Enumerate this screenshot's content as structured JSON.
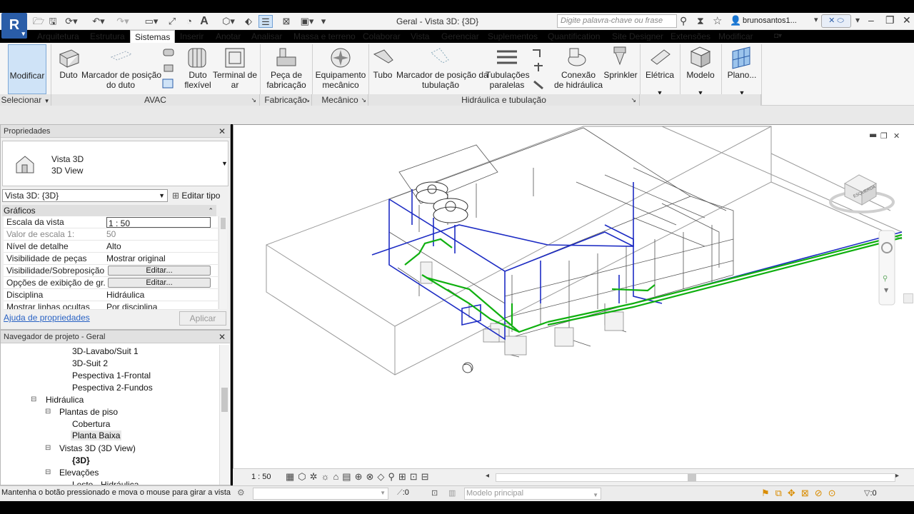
{
  "app": {
    "logo": "R",
    "title": "Geral - Vista 3D: {3D}",
    "search_placeholder": "Digite palavra-chave ou frase",
    "user": "brunosantos1..."
  },
  "quick_access": [
    "open-icon",
    "save-icon",
    "sync-icon",
    "undo-icon",
    "redo-icon",
    "measure-icon",
    "dimension-icon",
    "tag-icon",
    "text-icon",
    "3d-view-icon",
    "section-icon",
    "thin-lines-icon",
    "close-views-icon",
    "switch-windows-icon"
  ],
  "tabs": [
    "Arquitetura",
    "Estrutura",
    "Sistemas",
    "Inserir",
    "Anotar",
    "Analisar",
    "Massa e terreno",
    "Colaborar",
    "Vista",
    "Gerenciar",
    "Suplementos",
    "Quantification",
    "Site Designer",
    "Extensões",
    "Modificar"
  ],
  "active_tab": "Sistemas",
  "ribbon": {
    "buttons": [
      {
        "label": "Modificar",
        "icon": "cursor-icon"
      },
      {
        "label": "Duto",
        "icon": "duct-icon"
      },
      {
        "label": "Marcador de posição\ndo duto",
        "icon": "duct-placeholder-icon"
      },
      {
        "label": "Duto\nflexível",
        "icon": "flex-duct-icon"
      },
      {
        "label": "Terminal de\nar",
        "icon": "air-terminal-icon"
      },
      {
        "label": "Peça de\nfabricação",
        "icon": "fabrication-part-icon"
      },
      {
        "label": "Equipamento\nmecânico",
        "icon": "mechanical-equipment-icon"
      },
      {
        "label": "Tubo",
        "icon": "pipe-icon"
      },
      {
        "label": "Marcador de posição da\ntubulação",
        "icon": "pipe-placeholder-icon"
      },
      {
        "label": "Tubulações\nparalelas",
        "icon": "parallel-pipes-icon"
      },
      {
        "label": "Conexão\nde hidráulica",
        "icon": "plumbing-fixture-icon"
      },
      {
        "label": "Sprinkler",
        "icon": "sprinkler-icon"
      },
      {
        "label": "Elétrica",
        "icon": "electrical-icon"
      },
      {
        "label": "Modelo",
        "icon": "model-icon"
      },
      {
        "label": "Plano...",
        "icon": "work-plane-icon"
      }
    ],
    "panels": [
      "Selecionar",
      "AVAC",
      "Fabricação",
      "Mecânico",
      "Hidráulica e tubulação"
    ]
  },
  "properties": {
    "title": "Propriedades",
    "type_name": "Vista 3D",
    "type_sub": "3D View",
    "selector": "Vista 3D: {3D}",
    "edit_type": "Editar tipo",
    "section": "Gráficos",
    "rows": [
      {
        "k": "Escala da vista",
        "v": "1 : 50"
      },
      {
        "k": "Valor de escala    1:",
        "v": "50"
      },
      {
        "k": "Nível de detalhe",
        "v": "Alto"
      },
      {
        "k": "Visibilidade de peças",
        "v": "Mostrar original"
      },
      {
        "k": "Visibilidade/Sobreposição...",
        "v": "Editar..."
      },
      {
        "k": "Opções de exibição de gr...",
        "v": "Editar..."
      },
      {
        "k": "Disciplina",
        "v": "Hidráulica"
      },
      {
        "k": "Mostrar linhas ocultas",
        "v": "Por disciplina"
      }
    ],
    "help": "Ajuda de propriedades",
    "apply": "Aplicar"
  },
  "navigator": {
    "title": "Navegador de projeto - Geral",
    "items": [
      "3D-Lavabo/Suit 1",
      "3D-Suit 2",
      "Pespectiva 1-Frontal",
      "Pespectiva 2-Fundos",
      "Hidráulica",
      "Plantas de piso",
      "Cobertura",
      "Planta Baixa",
      "Vistas 3D (3D View)",
      "{3D}",
      "Elevações",
      "Leste - Hidráulica"
    ]
  },
  "viewcube": {
    "face_label": "ESQUERDA"
  },
  "view_controls": {
    "scale": "1 : 50"
  },
  "status": {
    "message": "Mantenha o botão pressionado e mova o mouse para girar a vista",
    "workset_count": ":0",
    "model": "Modelo principal",
    "filter_count": ":0"
  }
}
